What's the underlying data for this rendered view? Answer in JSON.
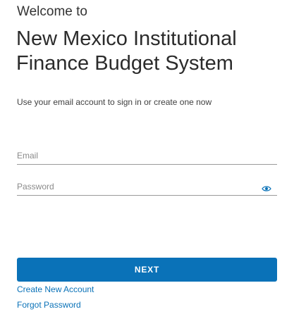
{
  "header": {
    "welcome": "Welcome to",
    "system_name": "New Mexico Institutional Finance Budget System",
    "subtitle": "Use your email account to sign in or create one now"
  },
  "form": {
    "email": {
      "value": "",
      "placeholder": "Email"
    },
    "password": {
      "value": "",
      "placeholder": "Password",
      "toggle_icon": "eye-icon"
    },
    "next_label": "NEXT"
  },
  "links": {
    "create_account": "Create New Account",
    "forgot_password": "Forgot Password"
  },
  "colors": {
    "accent": "#0a72b8",
    "text": "#333333",
    "placeholder": "#8a8a8a",
    "underline": "#9a9a9a"
  }
}
